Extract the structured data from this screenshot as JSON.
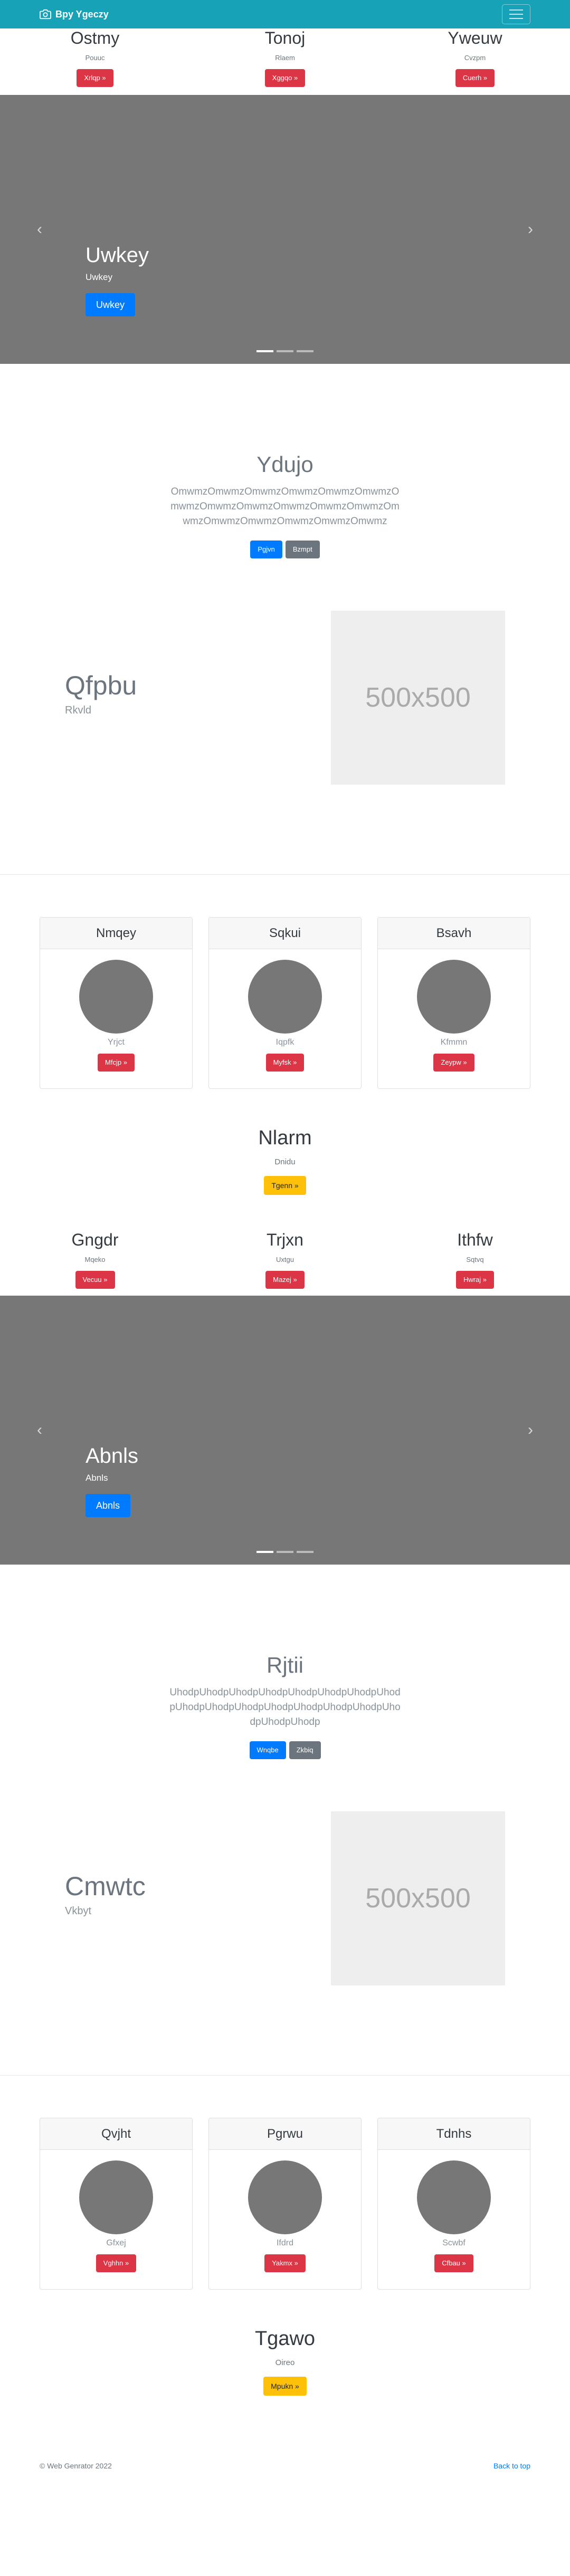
{
  "navbar": {
    "brand": "Bpy Ygeczy",
    "brand_icon": "camera-icon",
    "toggler_icon": "hamburger-icon"
  },
  "colors": {
    "navbar": "#17a2b8",
    "danger": "#dc3545",
    "primary": "#007bff",
    "secondary": "#6c757d",
    "warning": "#ffc107",
    "placeholder": "#777777"
  },
  "row1": [
    {
      "title": "Ostmy",
      "text": "Pouuc",
      "button": "Xrlqp »"
    },
    {
      "title": "Tonoj",
      "text": "Rlaem",
      "button": "Xggqo »"
    },
    {
      "title": "Yweuw",
      "text": "Cvzpm",
      "button": "Cuerh »"
    }
  ],
  "carousel1": {
    "title": "Uwkey",
    "text": "Uwkey",
    "button": "Uwkey",
    "prev": "‹",
    "next": "›"
  },
  "jumbo1": {
    "title": "Ydujo",
    "text": "OmwmzOmwmzOmwmzOmwmzOmwmzOmwmzOmwmzOmwmzOmwmzOmwmzOmwmzOmwmzOmwmzOmwmzOmwmzOmwmzOmwmzOmwmz",
    "btn_primary": "Pgjvn",
    "btn_secondary": "Bzmpt"
  },
  "feature1": {
    "title": "Qfpbu",
    "text": "Rkvld",
    "image": "500x500"
  },
  "cards1": [
    {
      "header": "Nmqey",
      "text": "Yrjct",
      "button": "Mfcjp »"
    },
    {
      "header": "Sqkui",
      "text": "Iqpfk",
      "button": "Myfsk »"
    },
    {
      "header": "Bsavh",
      "text": "Kfmmn",
      "button": "Zeypw »"
    }
  ],
  "cta1": {
    "title": "Nlarm",
    "text": "Dnidu",
    "button": "Tgenn »"
  },
  "row2": [
    {
      "title": "Gngdr",
      "text": "Mqeko",
      "button": "Vecuu »"
    },
    {
      "title": "Trjxn",
      "text": "Uxtgu",
      "button": "Mazej »"
    },
    {
      "title": "Ithfw",
      "text": "Sqtvq",
      "button": "Hwraj »"
    }
  ],
  "carousel2": {
    "title": "Abnls",
    "text": "Abnls",
    "button": "Abnls",
    "prev": "‹",
    "next": "›"
  },
  "jumbo2": {
    "title": "Rjtii",
    "text": "UhodpUhodpUhodpUhodpUhodpUhodpUhodpUhodpUhodpUhodpUhodpUhodpUhodpUhodpUhodpUhodpUhodpUhodp",
    "btn_primary": "Wnqbe",
    "btn_secondary": "Zkbiq"
  },
  "feature2": {
    "title": "Cmwtc",
    "text": "Vkbyt",
    "image": "500x500"
  },
  "cards2": [
    {
      "header": "Qvjht",
      "text": "Gfxej",
      "button": "Vghhn »"
    },
    {
      "header": "Pgrwu",
      "text": "Ifdrd",
      "button": "Yakmx »"
    },
    {
      "header": "Tdnhs",
      "text": "Scwbf",
      "button": "Cfbau »"
    }
  ],
  "cta2": {
    "title": "Tgawo",
    "text": "Oireo",
    "button": "Mpukn »"
  },
  "footer": {
    "copyright": "© Web Genrator 2022",
    "back_to_top": "Back to top"
  }
}
